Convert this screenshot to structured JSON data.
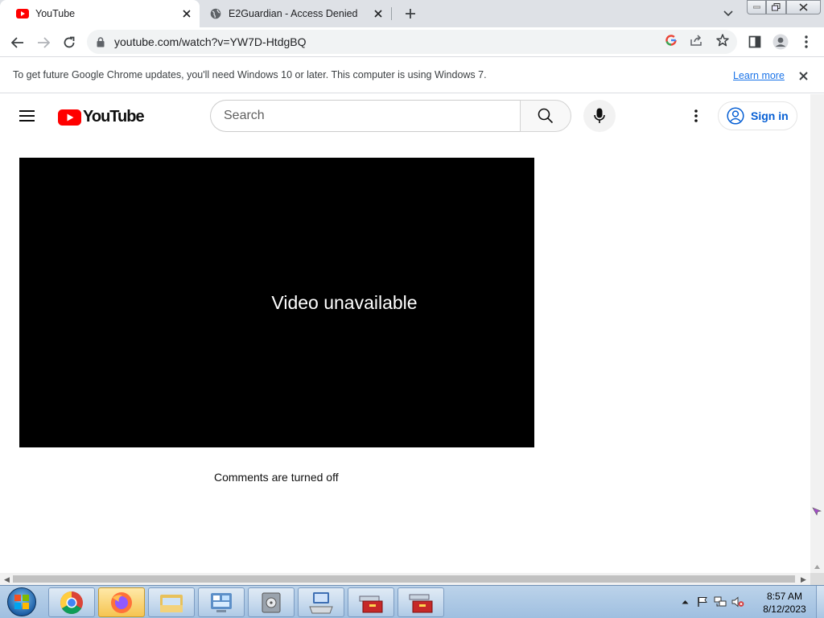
{
  "browser": {
    "tabs": [
      {
        "title": "YouTube",
        "favicon": "youtube-icon",
        "active": true
      },
      {
        "title": "E2Guardian - Access Denied",
        "favicon": "globe-icon",
        "active": false
      }
    ],
    "url": "youtube.com/watch?v=YW7D-HtdgBQ",
    "infobar": {
      "message": "To get future Google Chrome updates, you'll need Windows 10 or later. This computer is using Windows 7.",
      "link": "Learn more"
    }
  },
  "youtube": {
    "logo_text": "YouTube",
    "search_placeholder": "Search",
    "signin_label": "Sign in",
    "player_message": "Video unavailable",
    "comments_message": "Comments are turned off"
  },
  "taskbar": {
    "apps": [
      "chrome-icon",
      "firefox-icon",
      "file-explorer-icon",
      "control-panel-icon",
      "disk-icon",
      "keyboard-computer-icon",
      "toolbox-icon",
      "toolbox-icon"
    ],
    "time": "8:57 AM",
    "date": "8/12/2023"
  },
  "colors": {
    "youtube_red": "#ff0000",
    "link_blue": "#1a73e8",
    "signin_blue": "#065fd4",
    "tabstrip": "#dee1e6"
  }
}
